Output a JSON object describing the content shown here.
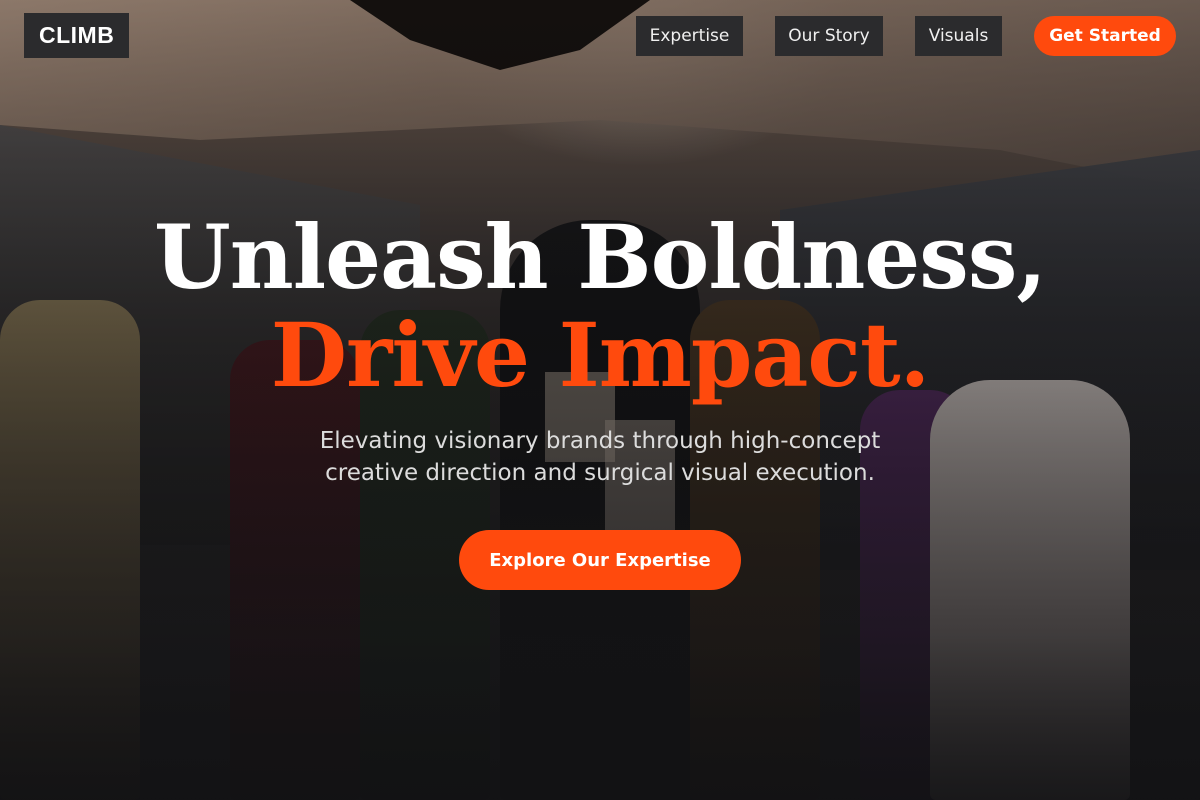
{
  "brand": {
    "logo_text": "CLIMB"
  },
  "nav": {
    "links": [
      "Expertise",
      "Our Story",
      "Visuals"
    ],
    "cta_label": "Get Started"
  },
  "hero": {
    "headline_line1": "Unleash Boldness,",
    "headline_line2": "Drive Impact.",
    "subheading": "Elevating visionary brands through high-concept creative direction and surgical visual execution.",
    "cta_label": "Explore Our Expertise"
  },
  "colors": {
    "accent": "#ff4a0d",
    "nav_button_bg": "#2b2b2d",
    "headline_text": "#ffffff",
    "background": "#1a1a1c"
  }
}
